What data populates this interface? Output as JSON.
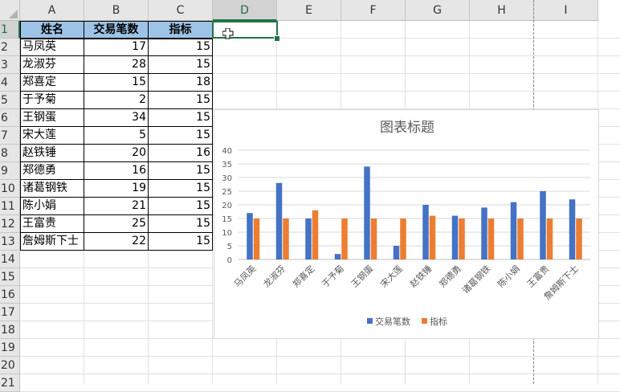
{
  "columns": [
    "A",
    "B",
    "C",
    "D",
    "E",
    "F",
    "G",
    "H",
    "I"
  ],
  "rows": [
    "1",
    "2",
    "3",
    "4",
    "5",
    "6",
    "7",
    "8",
    "9",
    "10",
    "11",
    "12",
    "13",
    "14",
    "15",
    "16",
    "17",
    "18",
    "19",
    "20",
    "21"
  ],
  "table": {
    "headers": [
      "姓名",
      "交易笔数",
      "指标"
    ],
    "rows": [
      [
        "马凤英",
        "17",
        "15"
      ],
      [
        "龙淑芬",
        "28",
        "15"
      ],
      [
        "郑喜定",
        "15",
        "18"
      ],
      [
        "于予菊",
        "2",
        "15"
      ],
      [
        "王钢蛋",
        "34",
        "15"
      ],
      [
        "宋大莲",
        "5",
        "15"
      ],
      [
        "赵铁锤",
        "20",
        "16"
      ],
      [
        "郑德勇",
        "16",
        "15"
      ],
      [
        "诸葛钢铁",
        "19",
        "15"
      ],
      [
        "陈小娟",
        "21",
        "15"
      ],
      [
        "王富贵",
        "25",
        "15"
      ],
      [
        "詹姆斯下士",
        "22",
        "15"
      ]
    ]
  },
  "selection": {
    "column": "D",
    "row": "1"
  },
  "colors": {
    "series1": "#4472c4",
    "series2": "#ed7d31",
    "header_fill": "#9dc3e6",
    "selection": "#217346"
  },
  "chart_data": {
    "type": "bar",
    "title": "图表标题",
    "categories": [
      "马凤英",
      "龙淑芬",
      "郑喜定",
      "于予菊",
      "王钢蛋",
      "宋大莲",
      "赵铁锤",
      "郑德勇",
      "诸葛钢铁",
      "陈小娟",
      "王富贵",
      "詹姆斯下士"
    ],
    "series": [
      {
        "name": "交易笔数",
        "values": [
          17,
          28,
          15,
          2,
          34,
          5,
          20,
          16,
          19,
          21,
          25,
          22
        ]
      },
      {
        "name": "指标",
        "values": [
          15,
          15,
          18,
          15,
          15,
          15,
          16,
          15,
          15,
          15,
          15,
          15
        ]
      }
    ],
    "ylim": [
      0,
      40
    ],
    "yticks": [
      0,
      5,
      10,
      15,
      20,
      25,
      30,
      35,
      40
    ],
    "grid": true,
    "legend": "bottom"
  }
}
